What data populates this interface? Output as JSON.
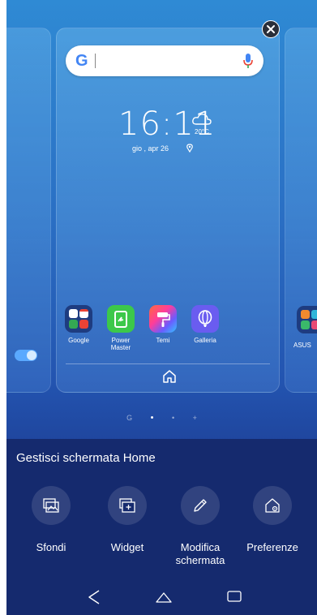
{
  "search": {
    "logo_letter": "G"
  },
  "clock": {
    "time": "16:11",
    "date": "gio , apr 26",
    "temperature": "20°C"
  },
  "apps": [
    {
      "label": "Google"
    },
    {
      "label": "Power\nMaster"
    },
    {
      "label": "Temi"
    },
    {
      "label": "Galleria"
    }
  ],
  "right_preview_app": {
    "label": "ASUS"
  },
  "page_indicator": [
    "G",
    "•",
    "•",
    "+"
  ],
  "sheet": {
    "title": "Gestisci schermata Home",
    "actions": [
      {
        "label": "Sfondi",
        "icon": "wallpaper-icon"
      },
      {
        "label": "Widget",
        "icon": "widget-icon"
      },
      {
        "label": "Modifica\nschermata",
        "icon": "pencil-icon"
      },
      {
        "label": "Preferenze",
        "icon": "home-settings-icon"
      }
    ]
  },
  "colors": {
    "accent": "#5aa9ff",
    "sheet_bg": "#152a6e"
  }
}
